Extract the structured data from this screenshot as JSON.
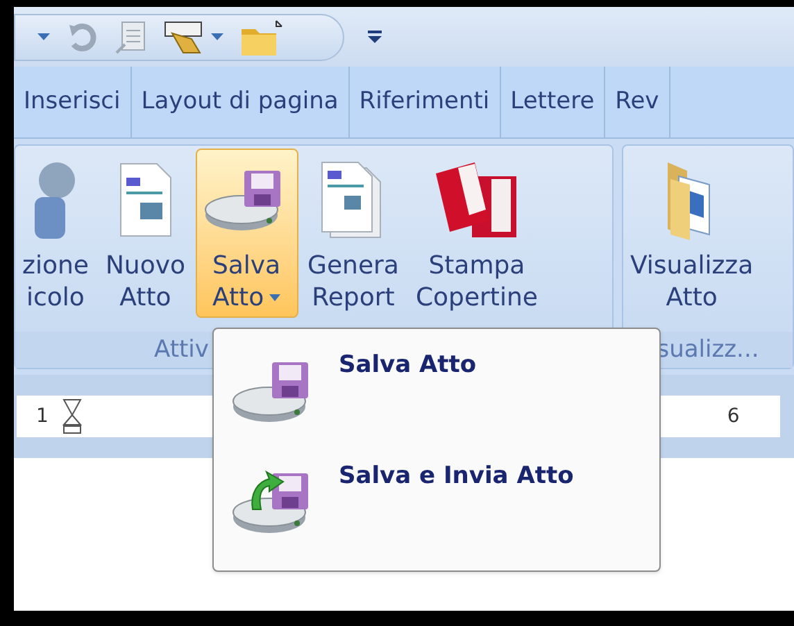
{
  "tabs": [
    {
      "label": "Inserisci",
      "selected": false
    },
    {
      "label": "Layout di pagina",
      "selected": false
    },
    {
      "label": "Riferimenti",
      "selected": false
    },
    {
      "label": "Lettere",
      "selected": false
    },
    {
      "label": "Rev",
      "selected": false
    }
  ],
  "ribbon": {
    "groups": [
      {
        "label": "Attiv",
        "buttons": [
          {
            "lines": [
              "zione",
              "icolo"
            ],
            "kind": "person",
            "selected": false,
            "has_menu": false
          },
          {
            "lines": [
              "Nuovo",
              "Atto"
            ],
            "kind": "doc",
            "selected": false,
            "has_menu": false
          },
          {
            "lines": [
              "Salva",
              "Atto"
            ],
            "kind": "drive",
            "selected": true,
            "has_menu": true
          },
          {
            "lines": [
              "Genera",
              "Report"
            ],
            "kind": "docs",
            "selected": false,
            "has_menu": false
          },
          {
            "lines": [
              "Stampa",
              "Copertine"
            ],
            "kind": "covers",
            "selected": false,
            "has_menu": false
          }
        ]
      },
      {
        "label": "sualizz...",
        "buttons": [
          {
            "lines": [
              "Visualizza",
              "Atto"
            ],
            "kind": "folder",
            "selected": false,
            "has_menu": false
          }
        ]
      }
    ]
  },
  "ruler": {
    "marks": [
      "1",
      "6"
    ]
  },
  "menu": {
    "items": [
      {
        "label": "Salva Atto",
        "kind": "save"
      },
      {
        "label": "Salva e Invia Atto",
        "kind": "send"
      }
    ]
  }
}
